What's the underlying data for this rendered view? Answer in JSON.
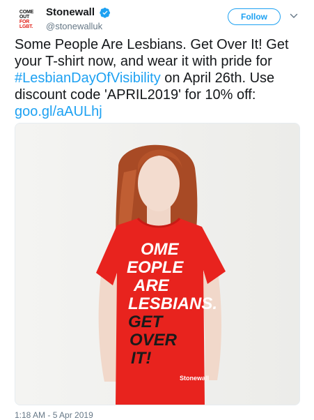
{
  "account": {
    "display_name": "Stonewall",
    "handle": "@stonewalluk",
    "avatar_lines": [
      "COME",
      "OUT",
      "FOR",
      "LGBT."
    ],
    "verified": true
  },
  "follow_label": "Follow",
  "tweet": {
    "text_part1": "Some People Are Lesbians. Get Over It! Get your T-shirt now, and wear it with pride for ",
    "hashtag": "#LesbianDayOfVisibility",
    "text_part2": " on April 26th. Use discount code 'APRIL2019' for 10% off: ",
    "link": "goo.gl/aAULhj",
    "timestamp": "1:18 AM - 5 Apr 2019"
  },
  "photo": {
    "shirt_lines": [
      "OME",
      "EOPLE",
      "ARE",
      "LESBIANS.",
      "GET",
      "OVER",
      "IT!"
    ],
    "shirt_brand": "Stonewall"
  },
  "colors": {
    "accent": "#1da1f2",
    "shirt": "#e8231e",
    "hair": "#b5532a",
    "avatar_red": "#e2231a"
  },
  "icons": [
    "verified-badge-icon",
    "chevron-down-icon"
  ]
}
